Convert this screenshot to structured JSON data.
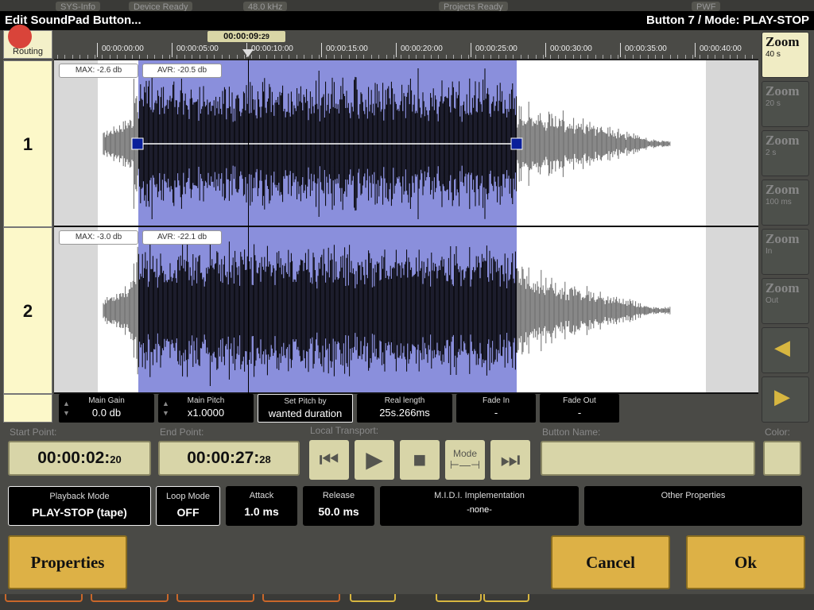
{
  "window": {
    "title": "Edit SoundPad Button...",
    "subtitle": "Button 7 / Mode: PLAY-STOP"
  },
  "background": {
    "items": [
      "SYS-Info",
      "Device Ready",
      "48.0 kHz",
      "Projects Ready",
      "PWF"
    ]
  },
  "routing": {
    "label": "Routing"
  },
  "timeline": {
    "position_main": "00:00:09",
    "position_frames": "29",
    "ticks": [
      "00:00:00:00",
      "00:00:05:00",
      "00:00:10:00",
      "00:00:15:00",
      "00:00:20:00",
      "00:00:25:00",
      "00:00:30:00",
      "00:00:35:00",
      "00:00:40:00"
    ]
  },
  "channels": [
    {
      "label": "1",
      "max": "MAX: -2.6 db",
      "avr": "AVR: -20.5 db"
    },
    {
      "label": "2",
      "max": "MAX: -3.0 db",
      "avr": "AVR: -22.1 db"
    }
  ],
  "zoom": [
    {
      "title": "Zoom",
      "sub": "40 s",
      "active": true
    },
    {
      "title": "Zoom",
      "sub": "20 s"
    },
    {
      "title": "Zoom",
      "sub": "2 s"
    },
    {
      "title": "Zoom",
      "sub": "100 ms"
    },
    {
      "title": "Zoom",
      "sub": "In"
    },
    {
      "title": "Zoom",
      "sub": "Out"
    }
  ],
  "controls": {
    "main_gain": {
      "title": "Main Gain",
      "value": "0.0 db"
    },
    "main_pitch": {
      "title": "Main Pitch",
      "value": "x1.0000"
    },
    "set_pitch": {
      "title": "Set Pitch by",
      "value": "wanted duration"
    },
    "real_length": {
      "title": "Real length",
      "value": "25s.266ms"
    },
    "fade_in": {
      "title": "Fade In",
      "value": "-"
    },
    "fade_out": {
      "title": "Fade Out",
      "value": "-"
    }
  },
  "start_point": {
    "label": "Start Point:",
    "main": "00:00:02",
    "frames": "20"
  },
  "end_point": {
    "label": "End Point:",
    "main": "00:00:27",
    "frames": "28"
  },
  "transport": {
    "label": "Local Transport:",
    "mode": "Mode"
  },
  "button_name": {
    "label": "Button Name:",
    "value": ""
  },
  "color": {
    "label": "Color:",
    "value": "#d8d5a8"
  },
  "properties": {
    "playback_mode": {
      "title": "Playback Mode",
      "value": "PLAY-STOP (tape)"
    },
    "loop_mode": {
      "title": "Loop Mode",
      "value": "OFF"
    },
    "attack": {
      "title": "Attack",
      "value": "1.0 ms"
    },
    "release": {
      "title": "Release",
      "value": "50.0 ms"
    },
    "midi": {
      "title": "M.I.D.I. Implementation",
      "value": "-none-"
    },
    "other": {
      "title": "Other Properties"
    }
  },
  "buttons": {
    "properties": "Properties",
    "cancel": "Cancel",
    "ok": "Ok"
  }
}
